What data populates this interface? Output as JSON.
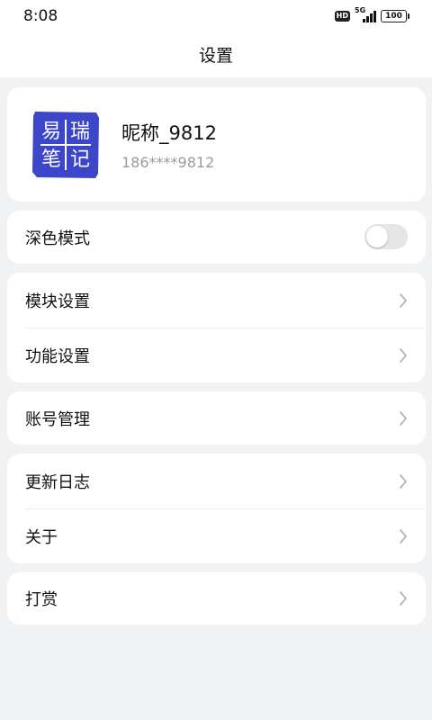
{
  "status_bar": {
    "time": "8:08",
    "hd_label": "HD",
    "network_label": "5G",
    "battery_level": "100"
  },
  "header": {
    "title": "设置"
  },
  "profile": {
    "nickname": "昵称_9812",
    "phone": "186****9812",
    "logo": {
      "chars": [
        "易",
        "瑞",
        "笔",
        "记"
      ],
      "color": "#3b46c9"
    }
  },
  "dark_mode": {
    "label": "深色模式",
    "enabled": false
  },
  "group_modules": [
    {
      "label": "模块设置"
    },
    {
      "label": "功能设置"
    }
  ],
  "group_account": [
    {
      "label": "账号管理"
    }
  ],
  "group_info": [
    {
      "label": "更新日志"
    },
    {
      "label": "关于"
    }
  ],
  "group_reward": [
    {
      "label": "打赏"
    }
  ],
  "icons": {
    "chevron": "chevron-right-icon",
    "signal": "signal-icon",
    "battery": "battery-icon"
  },
  "colors": {
    "background": "#f1f2f4",
    "card": "#ffffff",
    "secondary_text": "#9a9a9a",
    "toggle_off": "#e5e5e5",
    "logo_blue": "#3b46c9"
  }
}
